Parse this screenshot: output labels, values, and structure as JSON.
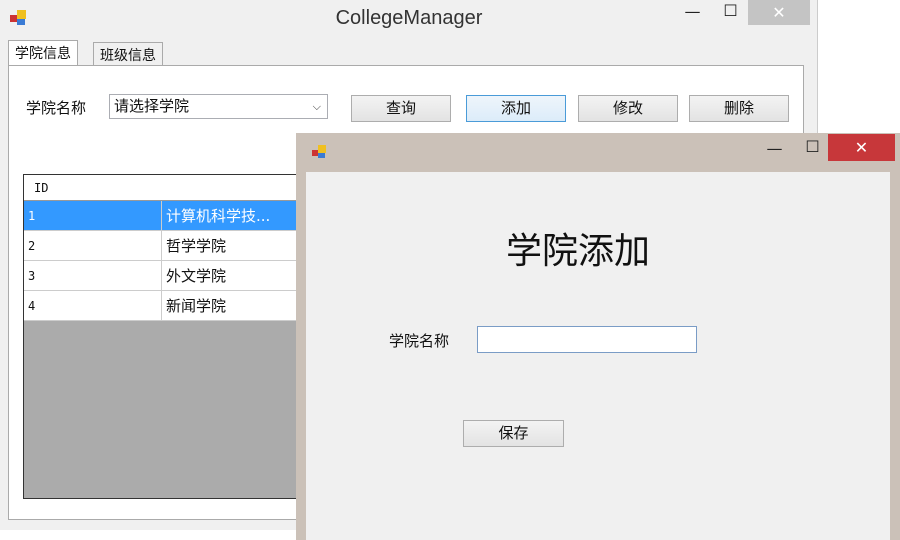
{
  "main_window": {
    "title": "CollegeManager",
    "tabs": [
      {
        "label": "学院信息"
      },
      {
        "label": "班级信息"
      }
    ],
    "filter": {
      "label": "学院名称",
      "combo_value": "请选择学院"
    },
    "buttons": {
      "query": "查询",
      "add": "添加",
      "edit": "修改",
      "delete": "删除"
    },
    "grid": {
      "columns": [
        "ID",
        ""
      ],
      "rows": [
        {
          "id": "1",
          "name": "计算机科学技..."
        },
        {
          "id": "2",
          "name": "哲学学院"
        },
        {
          "id": "3",
          "name": "外文学院"
        },
        {
          "id": "4",
          "name": "新闻学院"
        }
      ]
    }
  },
  "dialog": {
    "heading": "学院添加",
    "field_label": "学院名称",
    "field_value": "",
    "save_label": "保存"
  },
  "icons": {
    "minimize": "—",
    "maximize": "☐",
    "close": "✕"
  },
  "colors": {
    "selection": "#3399ff",
    "close_active": "#c7373a",
    "dialog_frame": "#cbc1b8"
  }
}
